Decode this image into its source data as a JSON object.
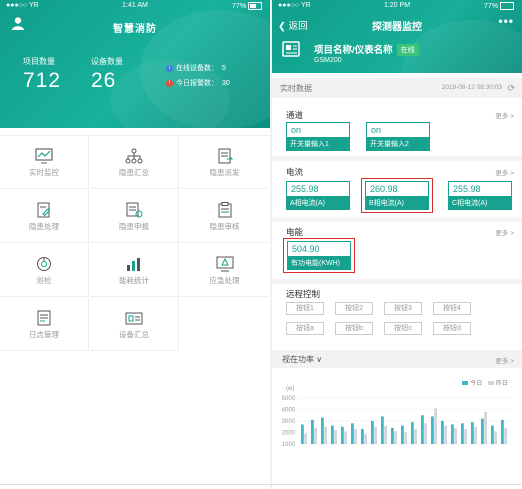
{
  "colors": {
    "primary": "#16a28f",
    "alert": "#d9302a",
    "online": "#3dc27a",
    "bar_today": "#41b8c8",
    "bar_yesterday": "#cfd6de"
  },
  "left": {
    "status_bar": {
      "carrier": "●●●○○ YR",
      "time": "1:41 AM",
      "battery": "77%"
    },
    "title": "智慧消防",
    "stats": [
      {
        "label": "项目数量",
        "value": "712"
      },
      {
        "label": "设备数量",
        "value": "26"
      }
    ],
    "online_devices": {
      "label": "在线设备数：",
      "value": "5"
    },
    "alarms_today": {
      "label": "今日报警数：",
      "value": "30"
    },
    "menu": [
      {
        "label": "实时监控",
        "icon": "monitor-chart-icon"
      },
      {
        "label": "隐患汇总",
        "icon": "hierarchy-icon"
      },
      {
        "label": "隐患派发",
        "icon": "dispatch-doc-icon"
      },
      {
        "label": "隐患处理",
        "icon": "edit-doc-icon"
      },
      {
        "label": "隐患申报",
        "icon": "report-doc-icon"
      },
      {
        "label": "隐患审核",
        "icon": "audit-doc-icon"
      },
      {
        "label": "巡检",
        "icon": "inspection-icon"
      },
      {
        "label": "能耗统计",
        "icon": "bar-stats-icon"
      },
      {
        "label": "应急处理",
        "icon": "screen-emergency-icon"
      },
      {
        "label": "日志管理",
        "icon": "log-icon"
      },
      {
        "label": "设备汇总",
        "icon": "device-summary-icon"
      }
    ]
  },
  "right": {
    "status_bar": {
      "carrier": "●●●○○ YR",
      "time": "1:20 PM",
      "battery": "77%"
    },
    "back": "返回",
    "title": "探测器监控",
    "more": "•••",
    "device": {
      "name": "项目名称/仪表名称",
      "status": "在线",
      "model": "GSM200"
    },
    "realtime": {
      "label": "实时数据",
      "timestamp": "2019-08-12 08:30:03"
    },
    "channel": {
      "title": "通道",
      "more": "更多 >",
      "items": [
        {
          "value": "on",
          "name": "开关量输入1"
        },
        {
          "value": "on",
          "name": "开关量输入2"
        }
      ]
    },
    "current": {
      "title": "电流",
      "more": "更多 >",
      "items": [
        {
          "value": "255.98",
          "name": "A相电流(A)"
        },
        {
          "value": "260.98",
          "name": "B相电流(A)"
        },
        {
          "value": "255.98",
          "name": "C相电流(A)"
        }
      ]
    },
    "energy": {
      "title": "电能",
      "more": "更多 >",
      "items": [
        {
          "value": "504.90",
          "name": "有功电能(KWH)"
        }
      ]
    },
    "remote": {
      "title": "远程控制",
      "buttons": [
        "按钮1",
        "按钮2",
        "按钮3",
        "按钮4",
        "按钮a",
        "按钮b",
        "按钮c",
        "按钮d"
      ]
    },
    "power": {
      "label": "视在功率 ∨",
      "more": "更多 >"
    }
  },
  "chart_data": {
    "type": "bar",
    "ylabel": "(w)",
    "ylim": [
      1000,
      5000
    ],
    "yticks": [
      "5000",
      "4000",
      "3000",
      "2000",
      "1000"
    ],
    "series": [
      {
        "name": "今日",
        "values": [
          2700,
          3100,
          3300,
          2600,
          2500,
          2800,
          2300,
          3000,
          3400,
          2400,
          2600,
          2900,
          3500,
          3400,
          3000,
          2700,
          2800,
          2900,
          3200,
          2600,
          3100
        ]
      },
      {
        "name": "昨日",
        "values": [
          1900,
          2400,
          2500,
          2200,
          2100,
          2300,
          1900,
          2500,
          2600,
          2100,
          2000,
          2300,
          2800,
          4100,
          2600,
          2400,
          2300,
          2500,
          3800,
          2100,
          2400
        ]
      }
    ]
  }
}
